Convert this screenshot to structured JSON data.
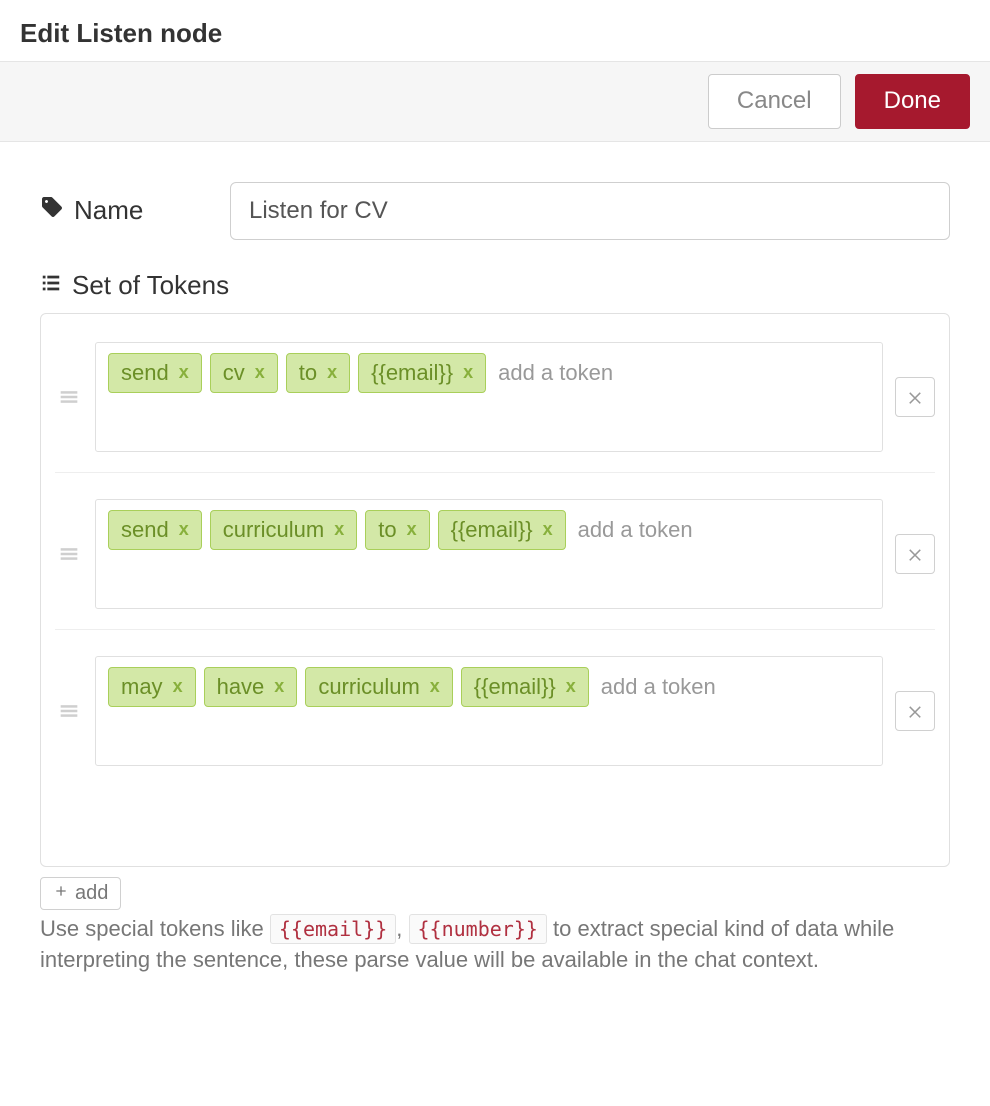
{
  "header": {
    "title": "Edit Listen node"
  },
  "actions": {
    "cancel": "Cancel",
    "done": "Done"
  },
  "name_field": {
    "label": "Name",
    "value": "Listen for CV"
  },
  "tokens_section": {
    "label": "Set of Tokens",
    "add_token_placeholder": "add a token",
    "tag_remove": "x",
    "rows": [
      {
        "tokens": [
          "send",
          "cv",
          "to",
          "{{email}}"
        ]
      },
      {
        "tokens": [
          "send",
          "curriculum",
          "to",
          "{{email}}"
        ]
      },
      {
        "tokens": [
          "may",
          "have",
          "curriculum",
          "{{email}}"
        ]
      }
    ],
    "add_button": "add"
  },
  "help": {
    "prefix": "Use special tokens like ",
    "token1": "{{email}}",
    "sep": ", ",
    "token2": "{{number}}",
    "suffix": " to extract special kind of data while interpreting the sentence, these parse value will be available in the chat context."
  }
}
